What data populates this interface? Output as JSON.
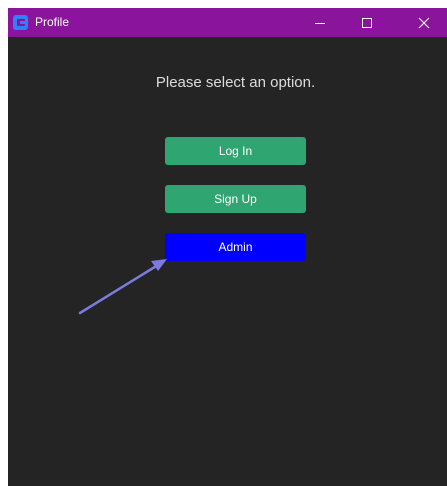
{
  "window": {
    "title": "Profile",
    "titlebar_color": "#8a159c",
    "background_color": "#242424",
    "icons": [
      "app-icon",
      "minimize-icon",
      "maximize-icon",
      "close-icon"
    ]
  },
  "main": {
    "prompt": "Please select an option.",
    "buttons": [
      {
        "label": "Log In",
        "color": "#2fa571"
      },
      {
        "label": "Sign Up",
        "color": "#2fa571"
      },
      {
        "label": "Admin",
        "color": "#0000ff"
      }
    ]
  },
  "annotation": {
    "type": "arrow",
    "points_to": "admin-button",
    "color": "#7b7be0"
  }
}
